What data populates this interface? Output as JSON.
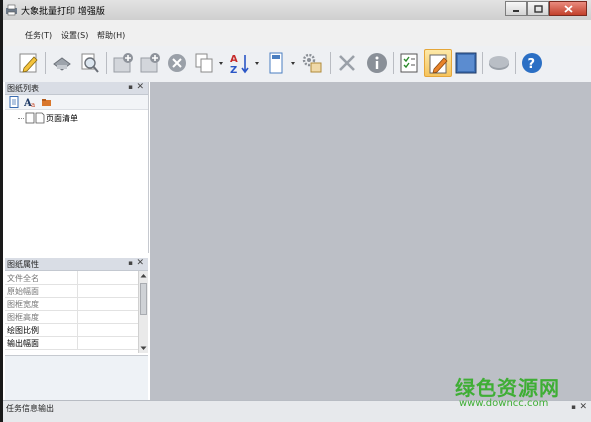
{
  "window": {
    "title": "大象批量打印 增强版"
  },
  "menu": [
    {
      "label": "任务(T)"
    },
    {
      "label": "设置(S)"
    },
    {
      "label": "帮助(H)"
    }
  ],
  "toolbar": {
    "icons": [
      "edit-icon",
      "print-icon",
      "print-preview-icon",
      "add-icon",
      "add-page-icon",
      "remove-icon",
      "copy-icon",
      "sort-az-icon",
      "layout-icon",
      "gear-icon",
      "tools-icon",
      "info-icon",
      "checklist-icon",
      "draw-icon",
      "frame-icon",
      "disk-icon",
      "help-icon"
    ]
  },
  "drawing_list_panel": {
    "title": "图纸列表",
    "tree_items": [
      {
        "label": "页面清单"
      }
    ]
  },
  "properties_panel": {
    "title": "图纸属性",
    "rows": [
      {
        "name": "文件全名",
        "value": "",
        "bold": false
      },
      {
        "name": "原始幅面",
        "value": "",
        "bold": false
      },
      {
        "name": "图框宽度",
        "value": "",
        "bold": false
      },
      {
        "name": "图框高度",
        "value": "",
        "bold": false
      },
      {
        "name": "绘图比例",
        "value": "",
        "bold": true
      },
      {
        "name": "输出幅面",
        "value": "",
        "bold": true
      }
    ]
  },
  "output_panel": {
    "title": "任务信息输出"
  },
  "watermark": {
    "text": "绿色资源网",
    "url": "www.downcc.com"
  },
  "colors": {
    "workspace": "#bcbfc6",
    "panel_header": "#d9dde5",
    "watermark": "#3fae35"
  }
}
